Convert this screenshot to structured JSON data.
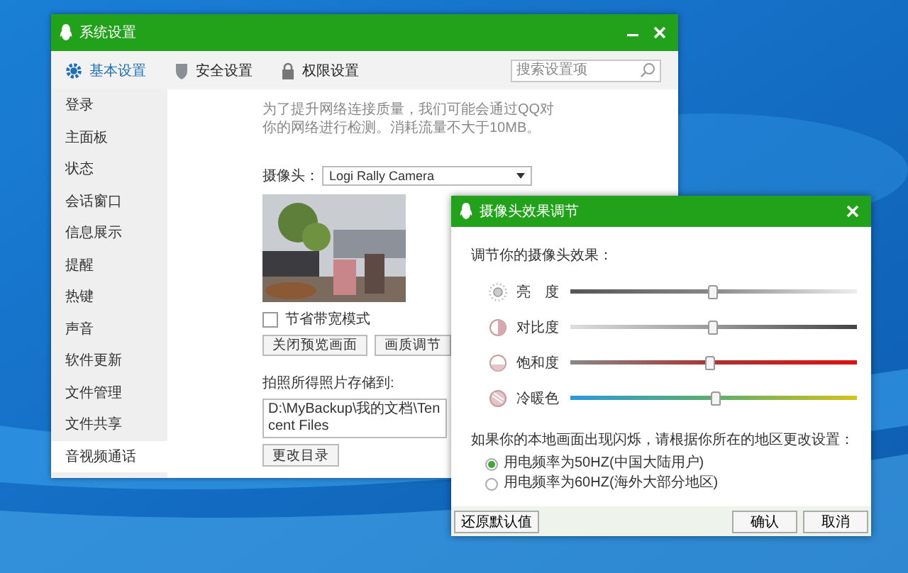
{
  "window": {
    "title": "系统设置",
    "search": {
      "placeholder": "搜索设置项"
    }
  },
  "tabs": [
    {
      "label": "基本设置",
      "selected": true
    },
    {
      "label": "安全设置",
      "selected": false
    },
    {
      "label": "权限设置",
      "selected": false
    }
  ],
  "sidebar": {
    "items": [
      {
        "label": "登录",
        "selected": false
      },
      {
        "label": "主面板",
        "selected": false
      },
      {
        "label": "状态",
        "selected": false
      },
      {
        "label": "会话窗口",
        "selected": false
      },
      {
        "label": "信息展示",
        "selected": false
      },
      {
        "label": "提醒",
        "selected": false
      },
      {
        "label": "热键",
        "selected": false
      },
      {
        "label": "声音",
        "selected": false
      },
      {
        "label": "软件更新",
        "selected": false
      },
      {
        "label": "文件管理",
        "selected": false
      },
      {
        "label": "文件共享",
        "selected": false
      },
      {
        "label": "音视频通话",
        "selected": true
      }
    ]
  },
  "content": {
    "notice_lines": [
      "为了提升网络连接质量，我们可能会通过QQ对",
      "你的网络进行检测。消耗流量不大于10MB。"
    ],
    "camera": {
      "label": "摄像头：",
      "value": "Logi Rally Camera"
    },
    "bandwidth_saving": {
      "label": "节省带宽模式",
      "checked": false
    },
    "buttons": [
      "关闭预览画面",
      "画质调节"
    ],
    "save_path": {
      "label": "拍照所得照片存储到:",
      "value": "D:\\MyBackup\\我的文档\\Tencent Files"
    },
    "change_dir_button": "更改目录"
  },
  "dialog": {
    "title": "摄像头效果调节",
    "heading": "调节你的摄像头效果：",
    "sliders": [
      {
        "label": "亮　度",
        "level": 0.5
      },
      {
        "label": "对比度",
        "level": 0.5
      },
      {
        "label": "饱和度",
        "level": 0.49
      },
      {
        "label": "冷暖色",
        "level": 0.51
      }
    ],
    "flicker_note": "如果你的本地画面出现闪烁，请根据你所在的地区更改设置：",
    "options": [
      {
        "label": "用电频率为50HZ(中国大陆用户)",
        "selected": true
      },
      {
        "label": "用电频率为60HZ(海外大部分地区)",
        "selected": false
      }
    ],
    "reset_button": "还原默认值",
    "buttons": [
      "确认",
      "取消"
    ]
  }
}
